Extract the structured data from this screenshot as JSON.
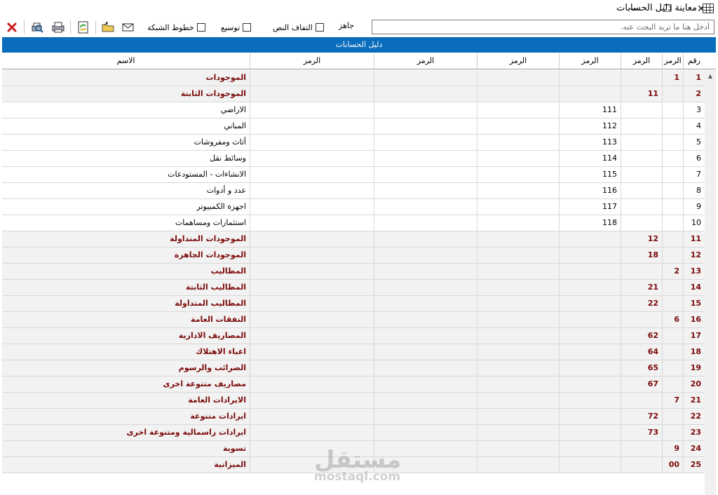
{
  "window": {
    "title": "معاينة دليل الحسابات",
    "minimize": "—",
    "maximize": "❐",
    "close": "✕"
  },
  "toolbar": {
    "status": "جاهز",
    "checkboxes": {
      "grid_lines": "خطوط الشبكة",
      "expand": "توسيع",
      "wrap_text": "التفاف النص"
    },
    "search_placeholder": "أدخل هنا ما تريد البحث عنه."
  },
  "grid": {
    "title": "دليل الحسابات",
    "headers": {
      "num": "رقم",
      "code1": "الرمز",
      "code2": "الرمز",
      "code3": "الرمز",
      "code4": "الرمز",
      "code5": "الرمز",
      "code6": "الرمز",
      "name": "الاسم"
    },
    "rows": [
      {
        "num": "1",
        "code1": "1",
        "code2": "",
        "code3": "",
        "name": "الموجودات",
        "bold": true
      },
      {
        "num": "2",
        "code1": "",
        "code2": "11",
        "code3": "",
        "name": "الموجودات الثابتة",
        "bold": true
      },
      {
        "num": "3",
        "code1": "",
        "code2": "",
        "code3": "111",
        "name": "الاراضي",
        "bold": false
      },
      {
        "num": "4",
        "code1": "",
        "code2": "",
        "code3": "112",
        "name": "المباني",
        "bold": false
      },
      {
        "num": "5",
        "code1": "",
        "code2": "",
        "code3": "113",
        "name": "أثاث ومفروشات",
        "bold": false
      },
      {
        "num": "6",
        "code1": "",
        "code2": "",
        "code3": "114",
        "name": "وسائط نقل",
        "bold": false
      },
      {
        "num": "7",
        "code1": "",
        "code2": "",
        "code3": "115",
        "name": "الانشاءات - المستودعات",
        "bold": false
      },
      {
        "num": "8",
        "code1": "",
        "code2": "",
        "code3": "116",
        "name": "عدد و أدوات",
        "bold": false
      },
      {
        "num": "9",
        "code1": "",
        "code2": "",
        "code3": "117",
        "name": "اجهزة الكمبيوتر",
        "bold": false
      },
      {
        "num": "10",
        "code1": "",
        "code2": "",
        "code3": "118",
        "name": "استثمارات ومساهمات",
        "bold": false
      },
      {
        "num": "11",
        "code1": "",
        "code2": "12",
        "code3": "",
        "name": "الموجودات المتداولة",
        "bold": true
      },
      {
        "num": "12",
        "code1": "",
        "code2": "18",
        "code3": "",
        "name": "الموجودات الجاهزة",
        "bold": true
      },
      {
        "num": "13",
        "code1": "2",
        "code2": "",
        "code3": "",
        "name": "المطاليب",
        "bold": true
      },
      {
        "num": "14",
        "code1": "",
        "code2": "21",
        "code3": "",
        "name": "المطاليب الثابتة",
        "bold": true
      },
      {
        "num": "15",
        "code1": "",
        "code2": "22",
        "code3": "",
        "name": "المطاليب المتداولة",
        "bold": true
      },
      {
        "num": "16",
        "code1": "6",
        "code2": "",
        "code3": "",
        "name": "النفقات العامة",
        "bold": true
      },
      {
        "num": "17",
        "code1": "",
        "code2": "62",
        "code3": "",
        "name": "المصاريف الادارية",
        "bold": true
      },
      {
        "num": "18",
        "code1": "",
        "code2": "64",
        "code3": "",
        "name": "اعباء الاهتلاك",
        "bold": true
      },
      {
        "num": "19",
        "code1": "",
        "code2": "65",
        "code3": "",
        "name": "الضرائب والرسوم",
        "bold": true
      },
      {
        "num": "20",
        "code1": "",
        "code2": "67",
        "code3": "",
        "name": "مصاريف متنوعة اخرى",
        "bold": true
      },
      {
        "num": "21",
        "code1": "7",
        "code2": "",
        "code3": "",
        "name": "الايرادات العامة",
        "bold": true
      },
      {
        "num": "22",
        "code1": "",
        "code2": "72",
        "code3": "",
        "name": "ايرادات متنوعة",
        "bold": true
      },
      {
        "num": "23",
        "code1": "",
        "code2": "73",
        "code3": "",
        "name": "ايرادات راسمالية ومتنوعة اخرى",
        "bold": true
      },
      {
        "num": "24",
        "code1": "9",
        "code2": "",
        "code3": "",
        "name": "تسوية",
        "bold": true
      },
      {
        "num": "25",
        "code1": "00",
        "code2": "",
        "code3": "",
        "name": "الميزانية",
        "bold": true
      }
    ]
  },
  "watermark": {
    "main": "مستقل",
    "sub": "mostaql.com"
  },
  "colors": {
    "header_bar": "#0a6cbc",
    "bold_text": "#7b0a0a",
    "close_icon": "#c81e1e"
  }
}
